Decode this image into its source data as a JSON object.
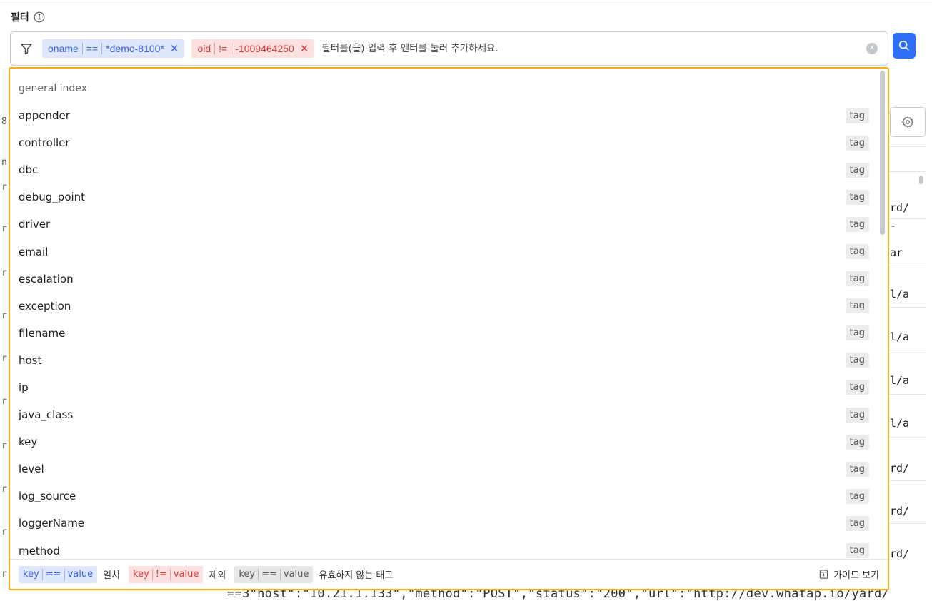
{
  "filter": {
    "title": "필터",
    "chips": [
      {
        "key": "oname",
        "op": "==",
        "value": "*demo-8100*",
        "type": "include"
      },
      {
        "key": "oid",
        "op": "!=",
        "value": "-1009464250",
        "type": "exclude"
      }
    ],
    "placeholder": "필터를(을) 입력 후 엔터를 눌러 추가하세요.",
    "remove_symbol": "✕"
  },
  "dropdown": {
    "group_label": "general index",
    "items": [
      {
        "name": "appender",
        "type": "tag"
      },
      {
        "name": "controller",
        "type": "tag"
      },
      {
        "name": "dbc",
        "type": "tag"
      },
      {
        "name": "debug_point",
        "type": "tag"
      },
      {
        "name": "driver",
        "type": "tag"
      },
      {
        "name": "email",
        "type": "tag"
      },
      {
        "name": "escalation",
        "type": "tag"
      },
      {
        "name": "exception",
        "type": "tag"
      },
      {
        "name": "filename",
        "type": "tag"
      },
      {
        "name": "host",
        "type": "tag"
      },
      {
        "name": "ip",
        "type": "tag"
      },
      {
        "name": "java_class",
        "type": "tag"
      },
      {
        "name": "key",
        "type": "tag"
      },
      {
        "name": "level",
        "type": "tag"
      },
      {
        "name": "log_source",
        "type": "tag"
      },
      {
        "name": "loggerName",
        "type": "tag"
      },
      {
        "name": "method",
        "type": "tag"
      }
    ]
  },
  "legend": {
    "items": [
      {
        "key": "key",
        "op": "==",
        "value": "value",
        "desc": "일치",
        "style": "blue"
      },
      {
        "key": "key",
        "op": "!=",
        "value": "value",
        "desc": "제외",
        "style": "red"
      },
      {
        "key": "key",
        "op": "==",
        "value": "value",
        "desc": "유효하지 않는 태그",
        "style": "gray"
      }
    ],
    "guide_label": "가이드 보기"
  },
  "background": {
    "left_chars": [
      "8",
      "n",
      "r",
      "r",
      "r",
      "r",
      "r",
      "r",
      "r",
      "r",
      "r",
      "r"
    ],
    "right_texts": [
      "rd/",
      "-",
      "ar",
      "l/a",
      "l/a",
      "l/a",
      "l/a",
      "rd/",
      "rd/",
      "rd/"
    ],
    "bottom_log": "==3\"host\":\"10.21.1.133\",\"method\":\"POST\",\"status\":\"200\",\"url\":\"http://dev.whatap.io/yard/"
  },
  "colors": {
    "accent": "#2f6ef7",
    "dropdown_border": "#f2b21c",
    "include_chip": "#dfe7fd",
    "exclude_chip": "#fde1e1"
  }
}
